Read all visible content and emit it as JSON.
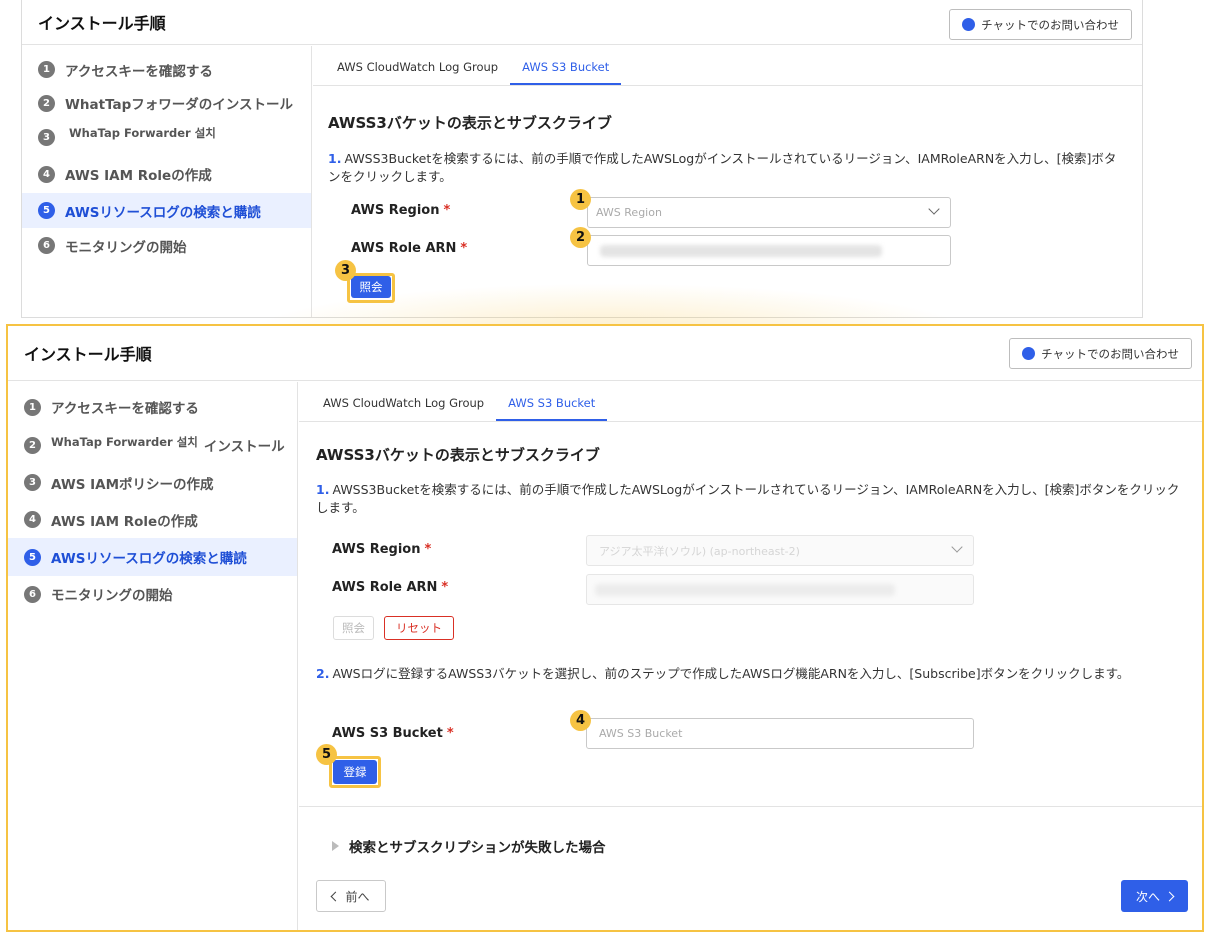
{
  "top": {
    "title": "インストール手順",
    "chat_button": "チャットでのお問い合わせ",
    "steps": [
      {
        "num": "1",
        "label": "アクセスキーを確認する"
      },
      {
        "num": "2",
        "label": "WhatTapフォワーダのインストール"
      },
      {
        "num": "3",
        "label": "WhaTap Forwarder 설치"
      },
      {
        "num": "4",
        "label": "AWS IAM Roleの作成"
      },
      {
        "num": "5",
        "label": "AWSリソースログの検索と購読"
      },
      {
        "num": "6",
        "label": "モニタリングの開始"
      }
    ],
    "tabs": [
      "AWS CloudWatch Log Group",
      "AWS S3 Bucket"
    ],
    "section_title": "AWSS3バケットの表示とサブスクライブ",
    "instruction1_num": "1.",
    "instruction1": "AWSS3Bucketを検索するには、前の手順で作成したAWSLogがインストールされているリージョン、IAMRoleARNを入力し、[検索]ボタンをクリックします。",
    "region_label": "AWS Region",
    "region_placeholder": "AWS Region",
    "role_label": "AWS Role ARN",
    "required_mark": "*",
    "search_button": "照会",
    "badges": [
      "1",
      "2",
      "3"
    ]
  },
  "bottom": {
    "title": "インストール手順",
    "chat_button": "チャットでのお問い合わせ",
    "steps": [
      {
        "num": "1",
        "label": "アクセスキーを確認する"
      },
      {
        "num": "2",
        "label": "WhaTap Forwarder 설치",
        "suffix": "インストール"
      },
      {
        "num": "3",
        "label": "AWS IAMポリシーの作成"
      },
      {
        "num": "4",
        "label": "AWS IAM Roleの作成"
      },
      {
        "num": "5",
        "label": "AWSリソースログの検索と購読"
      },
      {
        "num": "6",
        "label": "モニタリングの開始"
      }
    ],
    "tabs": [
      "AWS CloudWatch Log Group",
      "AWS S3 Bucket"
    ],
    "section_title": "AWSS3バケットの表示とサブスクライブ",
    "instruction1_num": "1.",
    "instruction1": "AWSS3Bucketを検索するには、前の手順で作成したAWSLogがインストールされているリージョン、IAMRoleARNを入力し、[検索]ボタンをクリックします。",
    "region_label": "AWS Region",
    "region_value": "アジア太平洋(ソウル) (ap-northeast-2)",
    "role_label": "AWS Role ARN",
    "required_mark": "*",
    "search_button": "照会",
    "reset_button": "リセット",
    "instruction2_num": "2.",
    "instruction2": "AWSログに登録するAWSS3バケットを選択し、前のステップで作成したAWSログ機能ARNを入力し、[Subscribe]ボタンをクリックします。",
    "bucket_label": "AWS S3 Bucket",
    "bucket_placeholder": "AWS S3 Bucket",
    "register_button": "登録",
    "failure_section": "検索とサブスクリプションが失敗した場合",
    "prev_button": "前へ",
    "next_button": "次へ",
    "badges": [
      "4",
      "5"
    ]
  },
  "colors": {
    "accent": "#2f5fe8",
    "highlight": "#f6c343",
    "danger": "#d93025",
    "active_bg": "#eaf0ff"
  }
}
